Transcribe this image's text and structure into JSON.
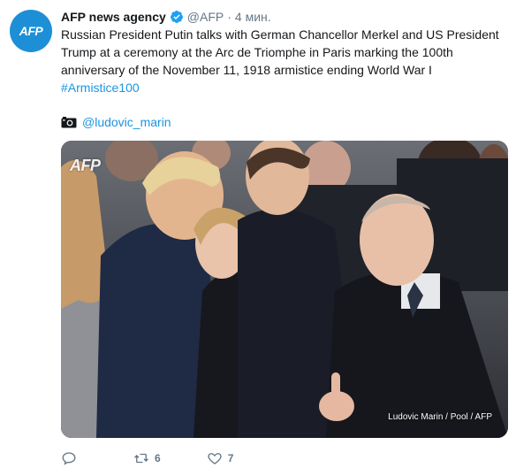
{
  "tweet": {
    "author_name": "AFP news agency",
    "handle": "@AFP",
    "separator": "·",
    "time": "4 мин.",
    "text": "Russian President Putin talks with German Chancellor Merkel and US President Trump at a ceremony at the Arc de Triomphe in Paris marking the 100th anniversary of the November 11, 1918 armistice ending World War I",
    "hashtag": "#Armistice100",
    "photo_mention": "@ludovic_marin"
  },
  "avatar": {
    "logo_text": "AFP",
    "color": "#1d8fd6"
  },
  "photo": {
    "watermark": "AFP",
    "credit": "Ludovic Marin / Pool / AFP"
  },
  "actions": {
    "reply_count": "",
    "retweet_count": "6",
    "like_count": "7"
  },
  "icons": {
    "verified": "verified-badge-icon",
    "camera": "camera-icon",
    "reply": "reply-icon",
    "retweet": "retweet-icon",
    "like": "heart-icon"
  },
  "colors": {
    "link": "#1b95e0",
    "muted": "#657786",
    "verified": "#1da1f2"
  }
}
